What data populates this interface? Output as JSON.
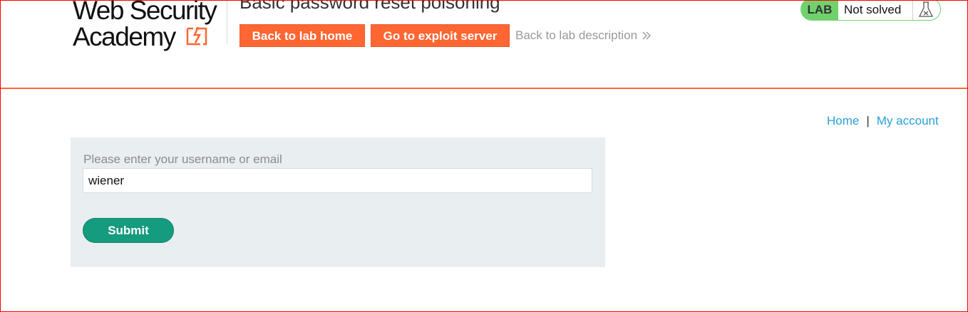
{
  "header": {
    "logo": {
      "line1": "Web Security",
      "line2": "Academy"
    },
    "lab_title": "Basic password reset poisoning",
    "back_to_lab_home": "Back to lab home",
    "go_to_exploit_server": "Go to exploit server",
    "back_to_lab_description": "Back to lab description",
    "lab_status": {
      "badge": "LAB",
      "text": "Not solved"
    }
  },
  "nav": {
    "home": "Home",
    "separator": "|",
    "my_account": "My account"
  },
  "form": {
    "label": "Please enter your username or email",
    "input_value": "wiener",
    "submit_label": "Submit"
  },
  "colors": {
    "accent": "#ff6633",
    "link": "#29a0d7",
    "submit": "#159b7e",
    "lab_badge": "#70d16d",
    "panel": "#e9eef0"
  }
}
